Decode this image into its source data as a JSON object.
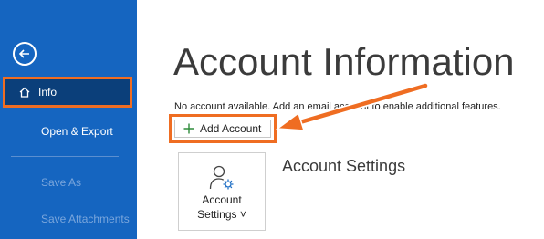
{
  "sidebar": {
    "back_icon": "back-arrow-icon",
    "items": [
      {
        "label": "Info",
        "icon": "home-icon"
      },
      {
        "label": "Open & Export"
      },
      {
        "label": "Save As"
      },
      {
        "label": "Save Attachments"
      }
    ]
  },
  "main": {
    "title": "Account Information",
    "info_text": "No account available. Add an email account to enable additional features.",
    "add_account_label": "Add Account",
    "add_account_icon": "plus-icon",
    "account_settings_tile": {
      "icon": "user-gear-icon",
      "line1": "Account",
      "line2": "Settings ˅"
    },
    "account_settings_heading": "Account Settings"
  },
  "colors": {
    "sidebar_bg": "#1565c0",
    "active_item_bg": "#0b3f7a",
    "highlight": "#ef6d22",
    "plus_green": "#2e8b3a"
  }
}
